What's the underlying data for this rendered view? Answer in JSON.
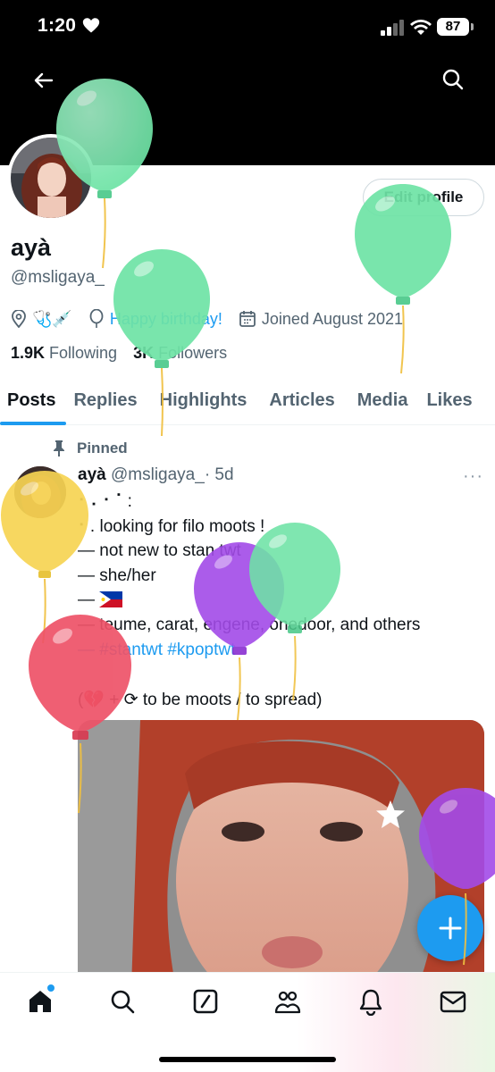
{
  "status_bar": {
    "time": "1:20",
    "battery": "87"
  },
  "profile": {
    "edit_label": "Edit profile",
    "display_name": "ayà",
    "handle": "@msligaya_",
    "bio_emoji": "🩺💉",
    "birthday": "Happy birthday!",
    "joined": "Joined August 2021",
    "following_count": "1.9K",
    "following_label": "Following",
    "followers_count": "3K",
    "followers_label": "Followers"
  },
  "tabs": [
    "Posts",
    "Replies",
    "Highlights",
    "Articles",
    "Media",
    "Likes"
  ],
  "post": {
    "pinned_label": "Pinned",
    "author": "ayà",
    "handle": "@msligaya_",
    "time": "· 5d",
    "more": "···",
    "lines": [
      "⠂⠄⠂⠁:",
      "⠂. looking for filo moots !",
      "— not new to stan twt",
      "— she/her",
      "— ",
      "— teume, carat, engene, onedoor, and others",
      "— #stantwt #kpoptwt",
      "(💔 + ⟳ to be moots / to spread)"
    ]
  },
  "colors": {
    "accent": "#1d9bf0",
    "balloon_green": "#6ee3a6",
    "balloon_yellow": "#f7d453",
    "balloon_purple": "#a34be8",
    "balloon_red": "#ee5268"
  },
  "icons": [
    "heart-icon",
    "signal-icon",
    "wifi-icon",
    "back-arrow-icon",
    "search-icon",
    "location-icon",
    "balloon-icon",
    "calendar-icon",
    "pin-icon",
    "star-icon",
    "plus-icon",
    "home-icon",
    "explore-icon",
    "grok-icon",
    "communities-icon",
    "notifications-icon",
    "messages-icon"
  ]
}
